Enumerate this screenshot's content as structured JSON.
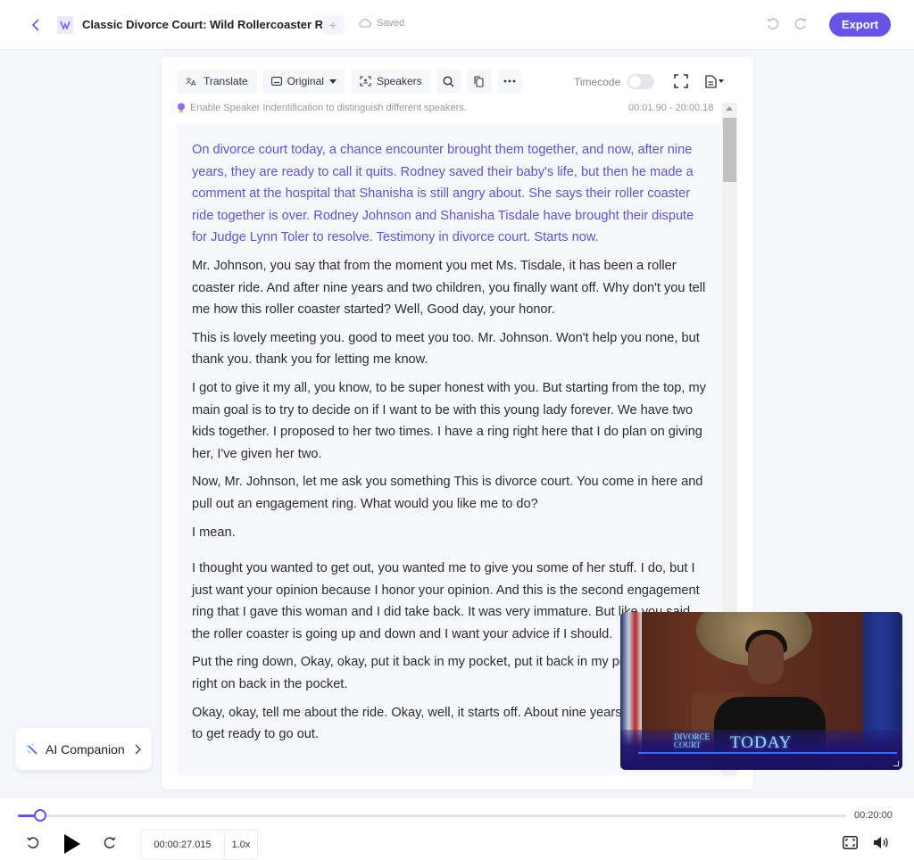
{
  "header": {
    "title": "Classic Divorce Court: Wild Rollercoaster Ride",
    "add_label": "+",
    "save_status": "Saved",
    "export_label": "Export"
  },
  "toolbar": {
    "translate_label": "Translate",
    "view_label": "Original",
    "speakers_label": "Speakers",
    "timecode_label": "Timecode",
    "timecode_enabled": false
  },
  "hint": "Enable Speaker Indentification to distinguish different speakers.",
  "time_range": "00:01.90 - 20:00.18",
  "transcript": [
    "On divorce court today, a chance encounter brought them together, and now, after nine years, they are ready to call it quits. Rodney saved their baby's life, but then he made a comment at the hospital that Shanisha is still angry about. She says their roller coaster ride together is over. Rodney Johnson and Shanisha Tisdale have brought their dispute for Judge Lynn Toler to resolve. Testimony in divorce court. Starts now.",
    "Mr. Johnson, you say that from the moment you met Ms. Tisdale, it has been a roller coaster ride. And after nine years and two children, you finally want off. Why don't you tell me how this roller coaster started? Well, Good day, your honor.",
    "This is lovely meeting you. good to meet you too. Mr. Johnson. Won't help you none, but thank you. thank you for letting me know.",
    "I got to give it my all, you know, to be super honest with you. But starting from the top, my main goal is to try to decide on if I want to be with this young lady forever. We have two kids together. I proposed to her two times. I have a ring right here that I do plan on giving her, I've given her two.",
    "Now, Mr. Johnson, let me ask you something This is divorce court. You come in here and pull out an engagement ring. What would you like me to do?",
    "I mean.",
    "I thought you wanted to get out, you wanted me to give you some of her stuff. I do, but I just want your opinion because I honor your opinion. And this is the second engagement ring that I gave this woman and I did take back. It was very immature. But like you said, the roller coaster is going up and down and I want your advice if I should.",
    "Put the ring down, Okay, okay, put it back in my pocket, put it back in my pocket, put it right on back in the pocket.",
    "Okay, okay, tell me about the ride. Okay, well, it starts off. About nine years ago, we used to get ready to go out."
  ],
  "video": {
    "overlay_brand_top": "DIVORCE",
    "overlay_brand_bottom": "COURT",
    "overlay_title": "TODAY"
  },
  "ai_companion": {
    "label": "AI Companion"
  },
  "player": {
    "current_time": "00:00:27.015",
    "duration": "00:20:00",
    "speed": "1.0x",
    "progress_percent": 2.7
  },
  "colors": {
    "accent": "#6654e8",
    "active_text": "#6050d8"
  }
}
